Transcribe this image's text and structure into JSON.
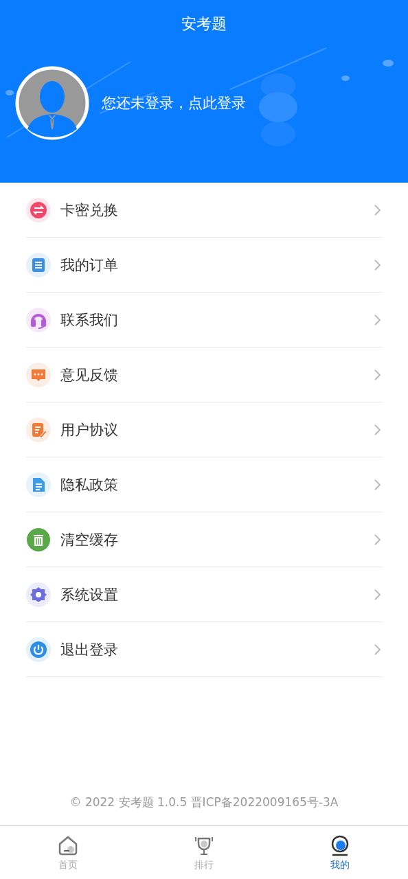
{
  "header": {
    "title": "安考题",
    "login_prompt": "您还未登录，点此登录"
  },
  "menu": [
    {
      "label": "卡密兑换",
      "kind": "exchange",
      "color": "#f0476a"
    },
    {
      "label": "我的订单",
      "kind": "order",
      "color": "#3b8fe6"
    },
    {
      "label": "联系我们",
      "kind": "support",
      "color": "#b65bd8"
    },
    {
      "label": "意见反馈",
      "kind": "feedback",
      "color": "#f07a36"
    },
    {
      "label": "用户协议",
      "kind": "agreement",
      "color": "#f07a36"
    },
    {
      "label": "隐私政策",
      "kind": "privacy",
      "color": "#3b9be6"
    },
    {
      "label": "清空缓存",
      "kind": "trash",
      "color": "#5aa84a"
    },
    {
      "label": "系统设置",
      "kind": "settings",
      "color": "#6c6ee0"
    },
    {
      "label": "退出登录",
      "kind": "power",
      "color": "#2d8fe6"
    }
  ],
  "footer": "© 2022 安考题 1.0.5 晋ICP备2022009165号-3A",
  "tabs": [
    {
      "label": "首页",
      "kind": "home",
      "selected": false
    },
    {
      "label": "排行",
      "kind": "trophy",
      "selected": false
    },
    {
      "label": "我的",
      "kind": "profile",
      "selected": true
    }
  ]
}
